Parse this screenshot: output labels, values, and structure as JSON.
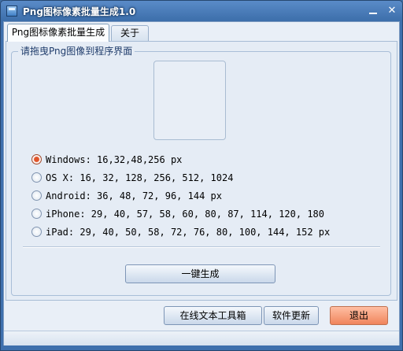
{
  "window": {
    "title": "Png图标像素批量生成1.0",
    "close_glyph": "✕"
  },
  "tabs": [
    {
      "label": "Png图标像素批量生成"
    },
    {
      "label": "关于"
    }
  ],
  "group": {
    "title": "请拖曳Png图像到程序界面"
  },
  "options": [
    {
      "label": "Windows: 16,32,48,256 px",
      "checked": true
    },
    {
      "label": "OS X: 16, 32, 128, 256, 512, 1024",
      "checked": false
    },
    {
      "label": "Android: 36, 48, 72, 96, 144 px",
      "checked": false
    },
    {
      "label": "iPhone: 29, 40, 57, 58, 60, 80, 87, 114, 120, 180",
      "checked": false
    },
    {
      "label": "iPad: 29, 40, 50, 58, 72, 76, 80, 100, 144, 152 px",
      "checked": false
    }
  ],
  "buttons": {
    "generate": "一键生成",
    "online_tools": "在线文本工具箱",
    "update": "软件更新",
    "exit": "退出"
  },
  "colors": {
    "accent_radio": "#e0542a",
    "exit_button": "#f0845c",
    "titlebar": "#3c6eaa"
  }
}
